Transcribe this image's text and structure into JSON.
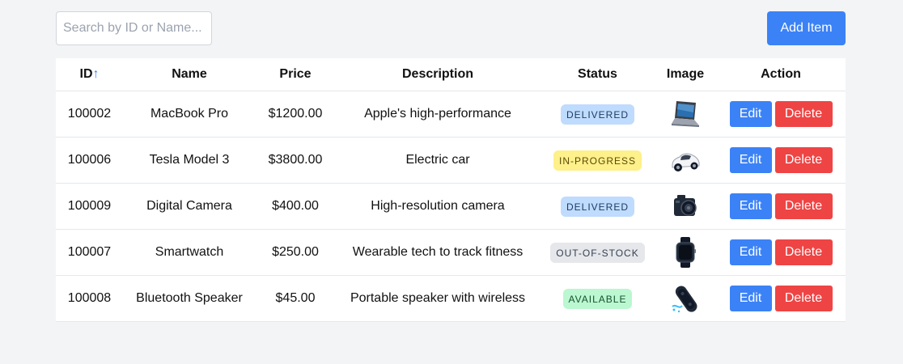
{
  "search": {
    "placeholder": "Search by ID or Name...",
    "value": ""
  },
  "toolbar": {
    "add_label": "Add Item"
  },
  "table": {
    "headers": {
      "id": "ID",
      "sort_indicator": "↑",
      "name": "Name",
      "price": "Price",
      "description": "Description",
      "status": "Status",
      "image": "Image",
      "action": "Action"
    },
    "rows": [
      {
        "id": "100002",
        "name": "MacBook Pro",
        "price": "$1200.00",
        "description": "Apple's high-performance",
        "status": "DELIVERED",
        "image_icon": "laptop-icon",
        "edit_label": "Edit",
        "delete_label": "Delete"
      },
      {
        "id": "100006",
        "name": "Tesla Model 3",
        "price": "$3800.00",
        "description": "Electric car",
        "status": "IN-PROGRESS",
        "image_icon": "car-icon",
        "edit_label": "Edit",
        "delete_label": "Delete"
      },
      {
        "id": "100009",
        "name": "Digital Camera",
        "price": "$400.00",
        "description": "High-resolution camera",
        "status": "DELIVERED",
        "image_icon": "camera-icon",
        "edit_label": "Edit",
        "delete_label": "Delete"
      },
      {
        "id": "100007",
        "name": "Smartwatch",
        "price": "$250.00",
        "description": "Wearable tech to track fitness",
        "status": "OUT-OF-STOCK",
        "image_icon": "smartwatch-icon",
        "edit_label": "Edit",
        "delete_label": "Delete"
      },
      {
        "id": "100008",
        "name": "Bluetooth Speaker",
        "price": "$45.00",
        "description": "Portable speaker with wireless",
        "status": "AVAILABLE",
        "image_icon": "speaker-icon",
        "edit_label": "Edit",
        "delete_label": "Delete"
      }
    ]
  },
  "colors": {
    "page_background": "#f3f4f6",
    "primary": "#3b82f6",
    "danger": "#ef4444",
    "status_delivered": "#bfdbfe",
    "status_in_progress": "#fef08a",
    "status_out_of_stock": "#e5e7eb",
    "status_available": "#bbf7d0"
  }
}
